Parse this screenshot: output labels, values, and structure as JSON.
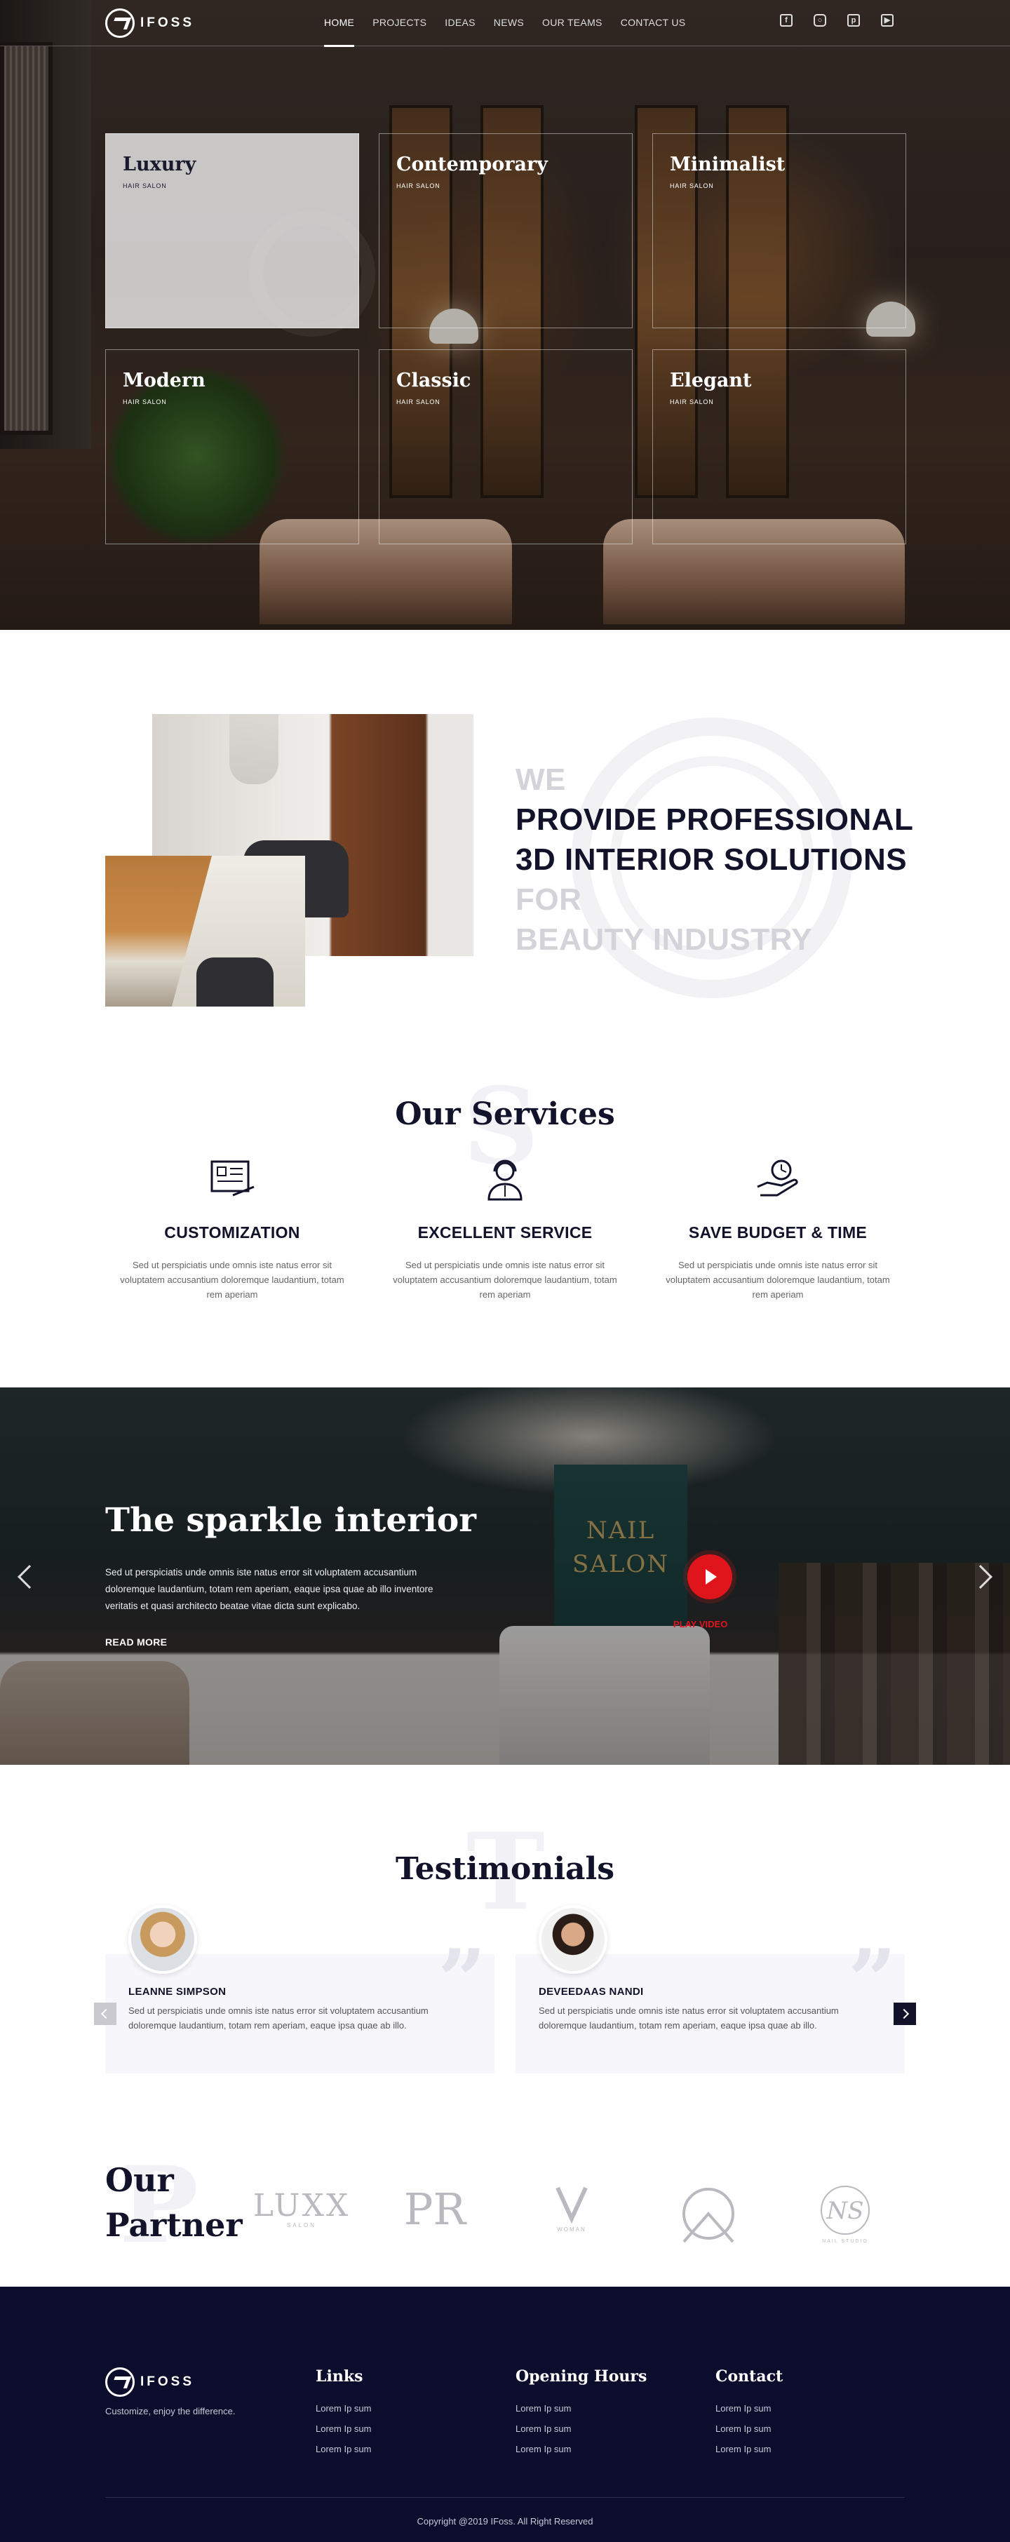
{
  "nav": {
    "brand": "IFOSS",
    "items": [
      "HOME",
      "PROJECTS",
      "IDEAS",
      "NEWS",
      "OUR TEAMS",
      "CONTACT US"
    ],
    "active_index": 0,
    "social_icons": [
      "facebook-icon",
      "instagram-icon",
      "pinterest-icon",
      "youtube-icon"
    ]
  },
  "hero": {
    "tiles": [
      {
        "title": "Luxury",
        "sub": "HAIR SALON"
      },
      {
        "title": "Contemporary",
        "sub": "HAIR SALON"
      },
      {
        "title": "Minimalist",
        "sub": "HAIR SALON"
      },
      {
        "title": "Modern",
        "sub": "HAIR SALON"
      },
      {
        "title": "Classic",
        "sub": "HAIR SALON"
      },
      {
        "title": "Elegant",
        "sub": "HAIR SALON"
      }
    ]
  },
  "provide": {
    "line1": "WE",
    "line2": "PROVIDE PROFESSIONAL",
    "line3": "3D INTERIOR SOLUTIONS",
    "line4": "FOR",
    "line5": "BEAUTY INDUSTRY"
  },
  "services": {
    "title": "Our Services",
    "bg_letter": "S",
    "items": [
      {
        "title": "CUSTOMIZATION",
        "text": "Sed ut perspiciatis unde omnis iste natus error sit voluptatem accusantium doloremque laudantium, totam rem aperiam",
        "icon": "blueprint-icon"
      },
      {
        "title": "EXCELLENT SERVICE",
        "text": "Sed ut perspiciatis unde omnis iste natus error sit voluptatem accusantium doloremque laudantium, totam rem aperiam",
        "icon": "support-agent-icon"
      },
      {
        "title": "SAVE BUDGET & TIME",
        "text": "Sed ut perspiciatis unde omnis iste natus error sit voluptatem accusantium doloremque laudantium, totam rem aperiam",
        "icon": "time-hand-icon"
      }
    ]
  },
  "slider": {
    "title": "The sparkle interior",
    "text": "Sed ut perspiciatis unde omnis iste natus error sit voluptatem accusantium doloremque laudantium, totam rem aperiam, eaque ipsa quae ab illo inventore veritatis et quasi architecto beatae vitae dicta sunt explicabo.",
    "read_more": "READ MORE",
    "play_label": "PLAY VIDEO",
    "sign_line1": "NAIL",
    "sign_line2": "SALON"
  },
  "testimonials": {
    "title": "Testimonials",
    "bg_letter": "T",
    "items": [
      {
        "name": "LEANNE SIMPSON",
        "text": "Sed ut perspiciatis unde omnis iste natus error sit voluptatem accusantium doloremque laudantium, totam rem aperiam, eaque ipsa quae ab illo."
      },
      {
        "name": "DEVEEDAAS NANDI",
        "text": "Sed ut perspiciatis unde omnis iste natus error sit voluptatem accusantium doloremque laudantium, totam rem aperiam, eaque ipsa quae ab illo."
      }
    ],
    "quote_glyph": "”"
  },
  "partner": {
    "title_line1": "Our",
    "title_line2": "Partner",
    "bg_letter": "P"
  },
  "footer": {
    "brand": "IFOSS",
    "tagline": "Customize, enjoy the difference.",
    "cols": [
      {
        "title": "Links",
        "items": [
          "Lorem Ip sum",
          "Lorem Ip sum",
          "Lorem Ip sum"
        ]
      },
      {
        "title": "Opening Hours",
        "items": [
          "Lorem Ip sum",
          "Lorem Ip sum",
          "Lorem Ip sum"
        ]
      },
      {
        "title": "Contact",
        "items": [
          "Lorem Ip sum",
          "Lorem Ip sum",
          "Lorem Ip sum"
        ]
      }
    ],
    "copyright": "Copyright @2019 IFoss. All Right Reserved"
  },
  "colors": {
    "navy": "#0c0c2c",
    "accent_red": "#e0151b",
    "light_gray": "#f7f7fb"
  }
}
